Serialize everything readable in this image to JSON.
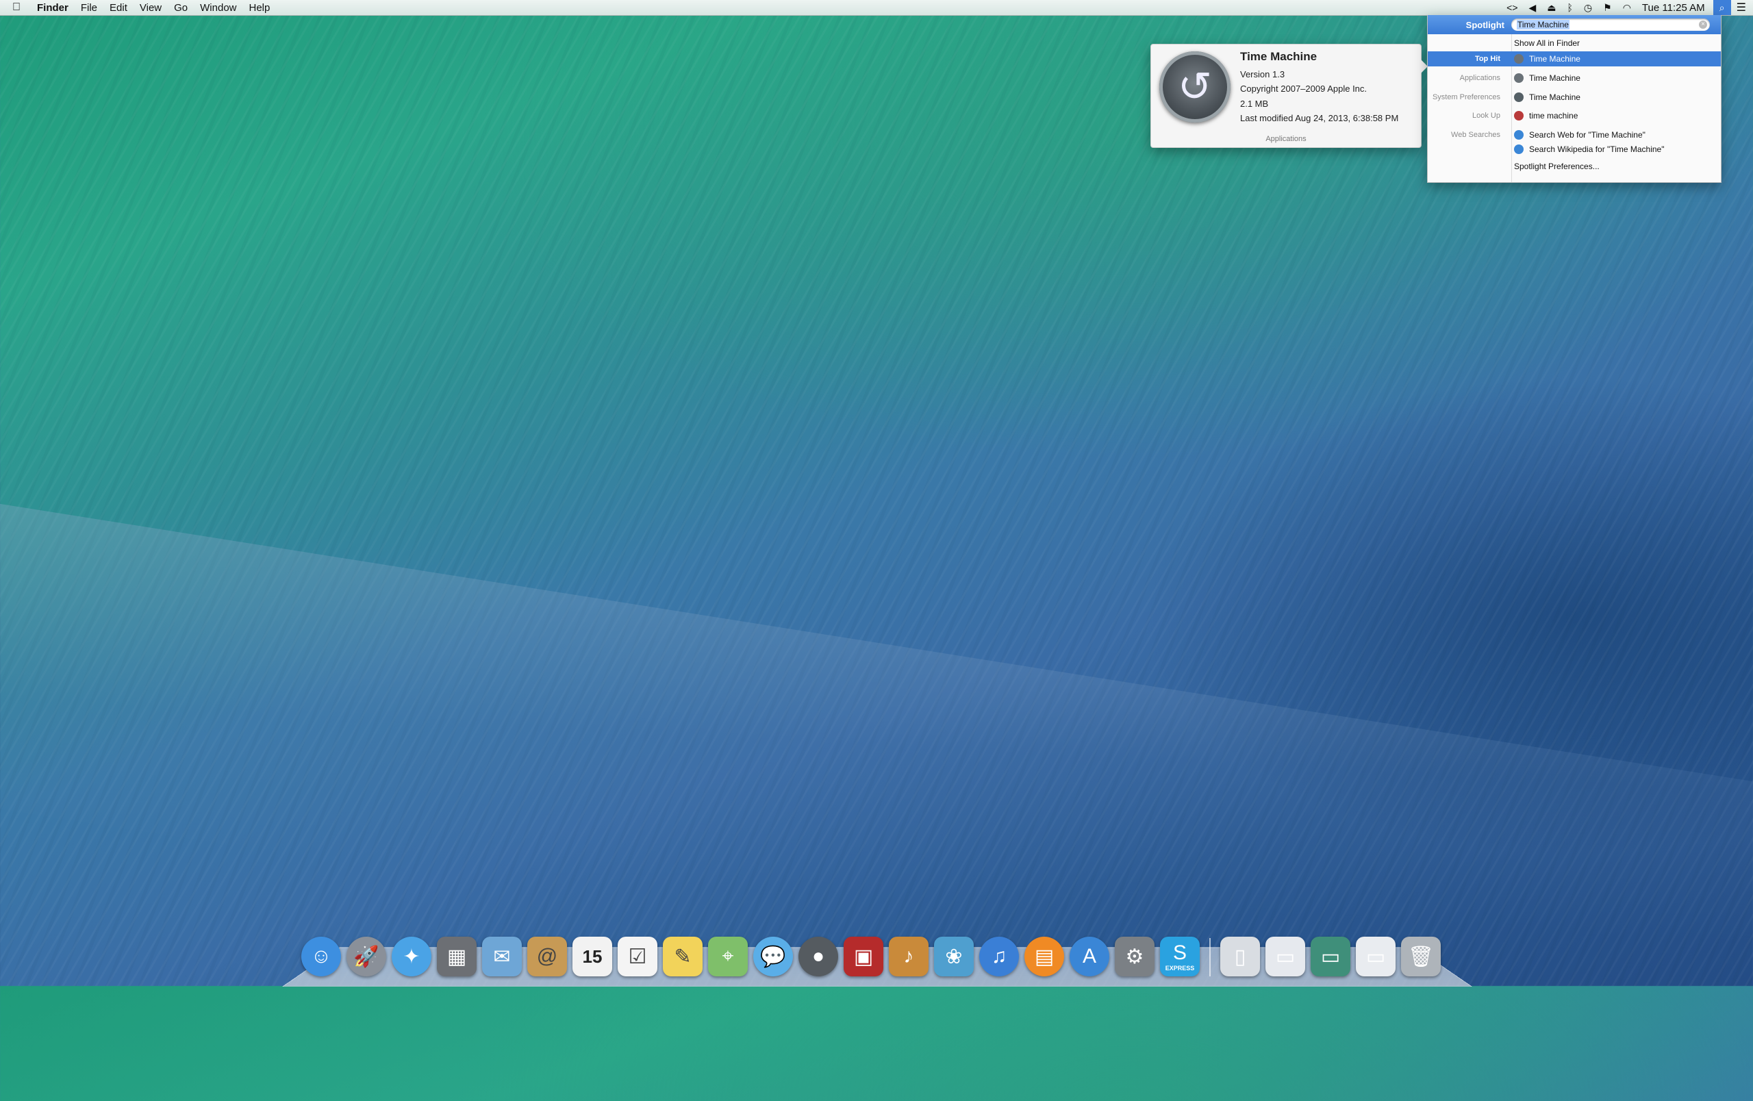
{
  "menubar": {
    "apple": "",
    "app_name": "Finder",
    "items": [
      "File",
      "Edit",
      "View",
      "Go",
      "Window",
      "Help"
    ],
    "status": {
      "clock": "Tue 11:25 AM"
    }
  },
  "spotlight": {
    "label": "Spotlight",
    "query": "Time Machine",
    "rows": [
      {
        "category": "",
        "text": "Show All in Finder",
        "selected": false,
        "icon": "",
        "color": ""
      },
      {
        "category": "Top Hit",
        "text": "Time Machine",
        "selected": true,
        "icon": "time-machine-icon",
        "color": "#6a7278"
      },
      {
        "category": "Applications",
        "text": "Time Machine",
        "selected": false,
        "icon": "time-machine-icon",
        "color": "#6a7278"
      },
      {
        "category": "System Preferences",
        "text": "Time Machine",
        "selected": false,
        "icon": "time-machine-prefs-icon",
        "color": "#556066"
      },
      {
        "category": "Look Up",
        "text": "time machine",
        "selected": false,
        "icon": "dictionary-icon",
        "color": "#b93a3a"
      },
      {
        "category": "Web Searches",
        "text": "Search Web for \"Time Machine\"",
        "selected": false,
        "icon": "globe-icon",
        "color": "#3a86d6"
      },
      {
        "category": "",
        "text": "Search Wikipedia for \"Time Machine\"",
        "selected": false,
        "icon": "globe-icon",
        "color": "#3a86d6"
      },
      {
        "category": "",
        "text": "Spotlight Preferences...",
        "selected": false,
        "icon": "",
        "color": ""
      }
    ]
  },
  "preview": {
    "title": "Time Machine",
    "version": "Version 1.3",
    "copyright": "Copyright 2007–2009 Apple Inc.",
    "size": "2.1 MB",
    "modified": "Last modified Aug 24, 2013, 6:38:58 PM",
    "location": "Applications"
  },
  "dock": {
    "express_label": "EXPRESS",
    "calendar_day": "15",
    "apps": [
      {
        "name": "finder-icon",
        "glyph": "☺",
        "bg": "#3d8fe0"
      },
      {
        "name": "launchpad-icon",
        "glyph": "🚀",
        "bg": "#8a9099"
      },
      {
        "name": "safari-icon",
        "glyph": "✦",
        "bg": "#4aa3e6"
      },
      {
        "name": "image-capture-icon",
        "glyph": "▦",
        "bg": "#6c6f74"
      },
      {
        "name": "mail-icon",
        "glyph": "✉",
        "bg": "#6ea6d6"
      },
      {
        "name": "contacts-icon",
        "glyph": "@",
        "bg": "#c79a55"
      },
      {
        "name": "calendar-icon",
        "glyph": "",
        "bg": "#f2f2f2"
      },
      {
        "name": "reminders-icon",
        "glyph": "☑",
        "bg": "#f4f4f4"
      },
      {
        "name": "notes-icon",
        "glyph": "✎",
        "bg": "#f2d35a"
      },
      {
        "name": "maps-icon",
        "glyph": "⌖",
        "bg": "#7fbf6a"
      },
      {
        "name": "messages-icon",
        "glyph": "💬",
        "bg": "#5aaee8"
      },
      {
        "name": "facetime-icon",
        "glyph": "●",
        "bg": "#555b60"
      },
      {
        "name": "photo-booth-icon",
        "glyph": "▣",
        "bg": "#b52b2b"
      },
      {
        "name": "garageband-icon",
        "glyph": "♪",
        "bg": "#c98a3a"
      },
      {
        "name": "iphoto-icon",
        "glyph": "❀",
        "bg": "#4f9fcf"
      },
      {
        "name": "itunes-icon",
        "glyph": "♫",
        "bg": "#3a7fd6"
      },
      {
        "name": "ibooks-icon",
        "glyph": "▤",
        "bg": "#f08a24"
      },
      {
        "name": "app-store-icon",
        "glyph": "A",
        "bg": "#3a86d6"
      },
      {
        "name": "system-preferences-icon",
        "glyph": "⚙",
        "bg": "#7b8085"
      },
      {
        "name": "skype-express-icon",
        "glyph": "S",
        "bg": "#2aa2e0"
      }
    ],
    "stacks": [
      {
        "name": "documents-stack-icon",
        "glyph": "▯",
        "bg": "#d9dde2"
      },
      {
        "name": "downloads-stack-icon",
        "glyph": "▭",
        "bg": "#e6e9ee"
      },
      {
        "name": "screenshot-stack-icon",
        "glyph": "▭",
        "bg": "#3f8f7a"
      },
      {
        "name": "applications-stack-icon",
        "glyph": "▭",
        "bg": "#e9ecf0"
      },
      {
        "name": "trash-icon",
        "glyph": "🗑",
        "bg": "#aeb4ba"
      }
    ]
  }
}
